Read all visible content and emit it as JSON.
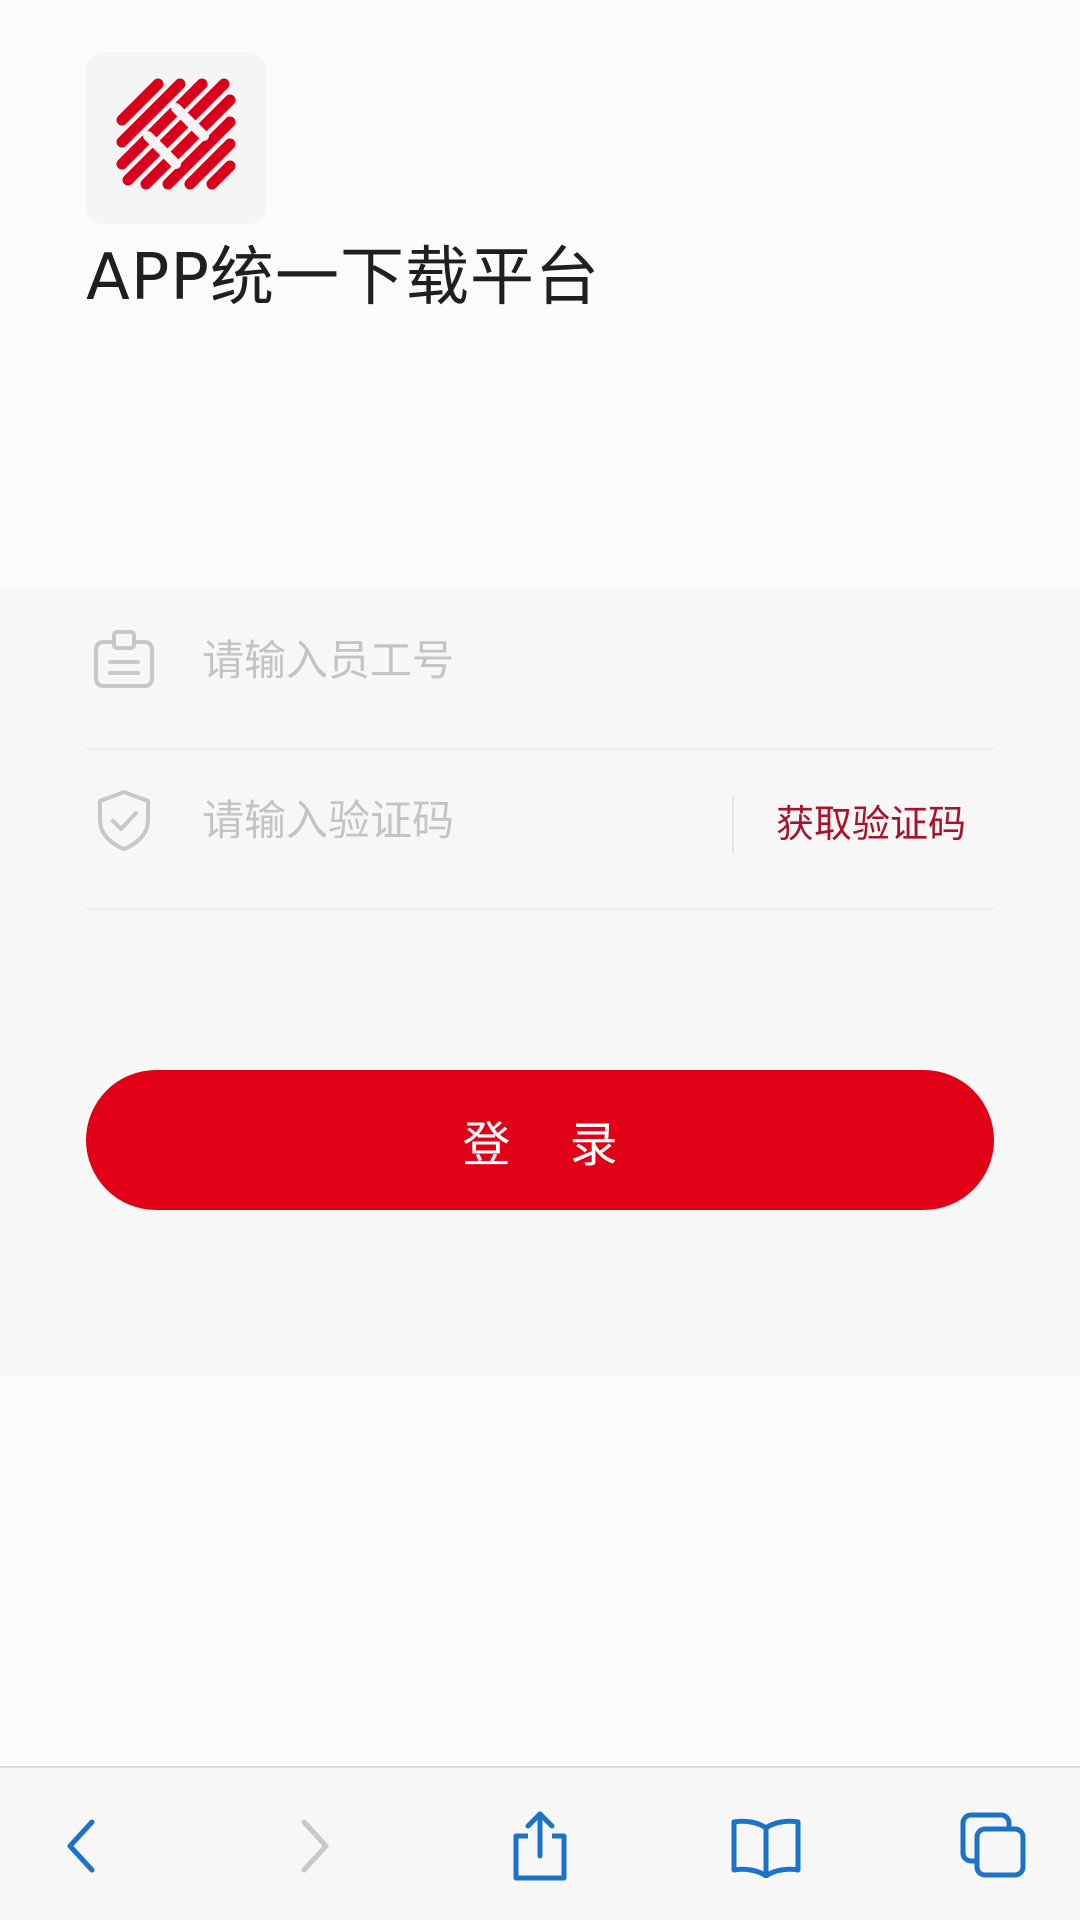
{
  "header": {
    "title": "APP统一下载平台",
    "logo_icon": "striped-brand-logo-icon",
    "brand_color": "#d9001b"
  },
  "form": {
    "employee_id": {
      "icon": "id-badge-icon",
      "value": "",
      "placeholder": "请输入员工号"
    },
    "verification_code": {
      "icon": "shield-check-icon",
      "value": "",
      "placeholder": "请输入验证码",
      "get_code_label": "获取验证码"
    },
    "login_label": "登 录"
  },
  "toolbar": {
    "items": [
      {
        "icon": "chevron-left-icon",
        "enabled": true
      },
      {
        "icon": "chevron-right-icon",
        "enabled": false
      },
      {
        "icon": "share-icon",
        "enabled": true
      },
      {
        "icon": "bookmarks-book-icon",
        "enabled": true
      },
      {
        "icon": "tabs-icon",
        "enabled": true
      }
    ],
    "accent_color": "#1a73c7",
    "disabled_color": "#c8c8cc"
  },
  "colors": {
    "primary_button": "#e10016",
    "link_red": "#a8132a",
    "placeholder": "#c4c4c6"
  }
}
